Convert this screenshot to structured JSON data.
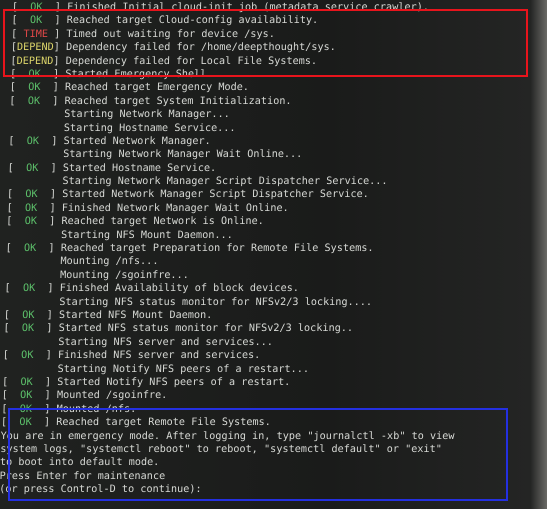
{
  "colors": {
    "ok": "#5cbf6a",
    "time": "#e04848",
    "depend": "#dcd56a",
    "text": "#d6d8d4",
    "highlight_red": "#e8141c",
    "highlight_blue": "#2430e0"
  },
  "lines": [
    {
      "status": "OK",
      "text": "Finished Initial cloud-init job (metadata service crawler)."
    },
    {
      "status": "OK",
      "text": "Reached target Cloud-config availability."
    },
    {
      "status": "TIME",
      "text": "Timed out waiting for device /sys."
    },
    {
      "status": "DEPEND",
      "text": "Dependency failed for /home/deepthought/sys."
    },
    {
      "status": "DEPEND",
      "text": "Dependency failed for Local File Systems."
    },
    {
      "status": "OK",
      "text": "Started Emergency Shell."
    },
    {
      "status": "OK",
      "text": "Reached target Emergency Mode."
    },
    {
      "status": "OK",
      "text": "Reached target System Initialization."
    },
    {
      "status": "",
      "text": "Starting Network Manager..."
    },
    {
      "status": "",
      "text": "Starting Hostname Service..."
    },
    {
      "status": "OK",
      "text": "Started Network Manager."
    },
    {
      "status": "",
      "text": "Starting Network Manager Wait Online..."
    },
    {
      "status": "OK",
      "text": "Started Hostname Service."
    },
    {
      "status": "",
      "text": "Starting Network Manager Script Dispatcher Service..."
    },
    {
      "status": "OK",
      "text": "Started Network Manager Script Dispatcher Service."
    },
    {
      "status": "OK",
      "text": "Finished Network Manager Wait Online."
    },
    {
      "status": "OK",
      "text": "Reached target Network is Online."
    },
    {
      "status": "",
      "text": "Starting NFS Mount Daemon..."
    },
    {
      "status": "OK",
      "text": "Reached target Preparation for Remote File Systems."
    },
    {
      "status": "",
      "text": "Mounting /nfs..."
    },
    {
      "status": "",
      "text": "Mounting /sgoinfre..."
    },
    {
      "status": "OK",
      "text": "Finished Availability of block devices."
    },
    {
      "status": "",
      "text": "Starting NFS status monitor for NFSv2/3 locking...."
    },
    {
      "status": "OK",
      "text": "Started NFS Mount Daemon."
    },
    {
      "status": "OK",
      "text": "Started NFS status monitor for NFSv2/3 locking.."
    },
    {
      "status": "",
      "text": "Starting NFS server and services..."
    },
    {
      "status": "OK",
      "text": "Finished NFS server and services."
    },
    {
      "status": "",
      "text": "Starting Notify NFS peers of a restart..."
    },
    {
      "status": "OK",
      "text": "Started Notify NFS peers of a restart."
    },
    {
      "status": "OK",
      "text": "Mounted /sgoinfre."
    },
    {
      "status": "OK",
      "text": "Mounted /nfs."
    },
    {
      "status": "OK",
      "text": "Reached target Remote File Systems."
    }
  ],
  "emergency": [
    "You are in emergency mode. After logging in, type \"journalctl -xb\" to view",
    "system logs, \"systemctl reboot\" to reboot, \"systemctl default\" or \"exit\"",
    "to boot into default mode.",
    "Press Enter for maintenance",
    "(or press Control-D to continue):"
  ]
}
